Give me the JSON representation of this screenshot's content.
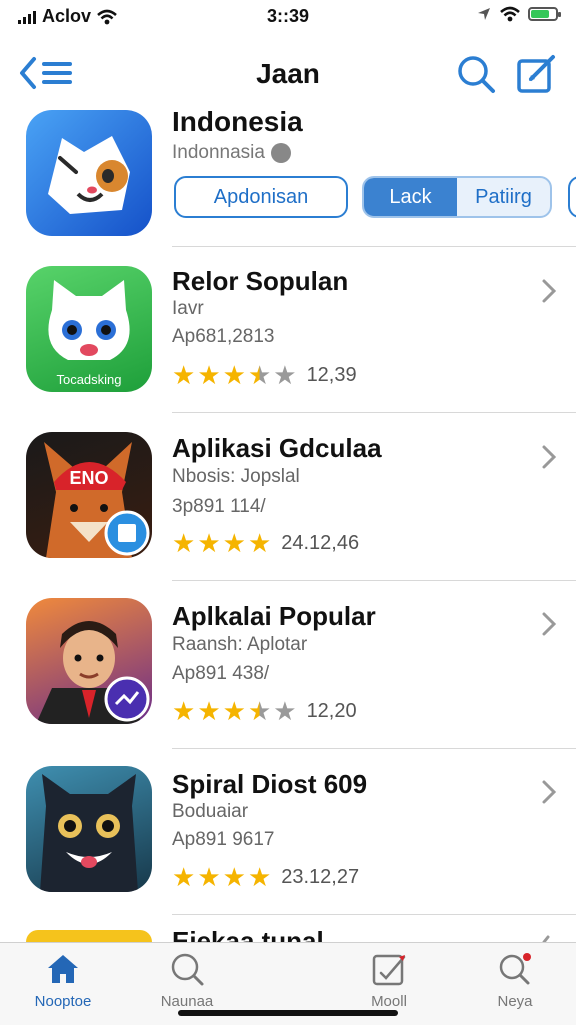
{
  "status_bar": {
    "carrier": "Aclov",
    "time": "3::39"
  },
  "nav": {
    "title": "Jaan"
  },
  "featured": {
    "title": "Indonesia",
    "subtitle": "Indonnasia",
    "button_left": "Apdonisan",
    "segments": [
      "Lack",
      "Patiirg"
    ],
    "selected_segment": "Lack"
  },
  "apps": [
    {
      "title": "Relor Sopulan",
      "subtitle": "Iavr",
      "meta": "Ap681,2813",
      "rating_stars": 3.5,
      "rating_text": "12,39",
      "icon": "white-cat-icon",
      "icon_label": "Tocadsking"
    },
    {
      "title": "Aplikasi Gdculaa",
      "subtitle": "Nbosis: Jopslal",
      "meta": "3p891 114/",
      "rating_stars": 4,
      "rating_text": "24.12,46",
      "icon": "fox-cap-icon",
      "icon_label": "ENO"
    },
    {
      "title": "Aplkalai Popular",
      "subtitle": "Raansh: Aplotar",
      "meta": "Ap891 438/",
      "rating_stars": 3.5,
      "rating_text": "12,20",
      "icon": "man-suit-icon"
    },
    {
      "title": "Spiral Diost 609",
      "subtitle": "Boduaiar",
      "meta": "Ap891 9617",
      "rating_stars": 4,
      "rating_text": "23.12,27",
      "icon": "black-cat-icon"
    }
  ],
  "partial_row": {
    "title": "Eiekaa tunal"
  },
  "tabs": [
    {
      "label": "Nooptoe",
      "icon": "home-icon",
      "active": true
    },
    {
      "label": "Naunaa",
      "icon": "search-icon",
      "active": false
    },
    {
      "label": "Mooll",
      "icon": "updates-icon",
      "active": false
    },
    {
      "label": "Neya",
      "icon": "search-badge-icon",
      "active": false
    }
  ],
  "colors": {
    "accent": "#2b7ed2",
    "star": "#f5b400",
    "active_tab": "#2467b6"
  }
}
